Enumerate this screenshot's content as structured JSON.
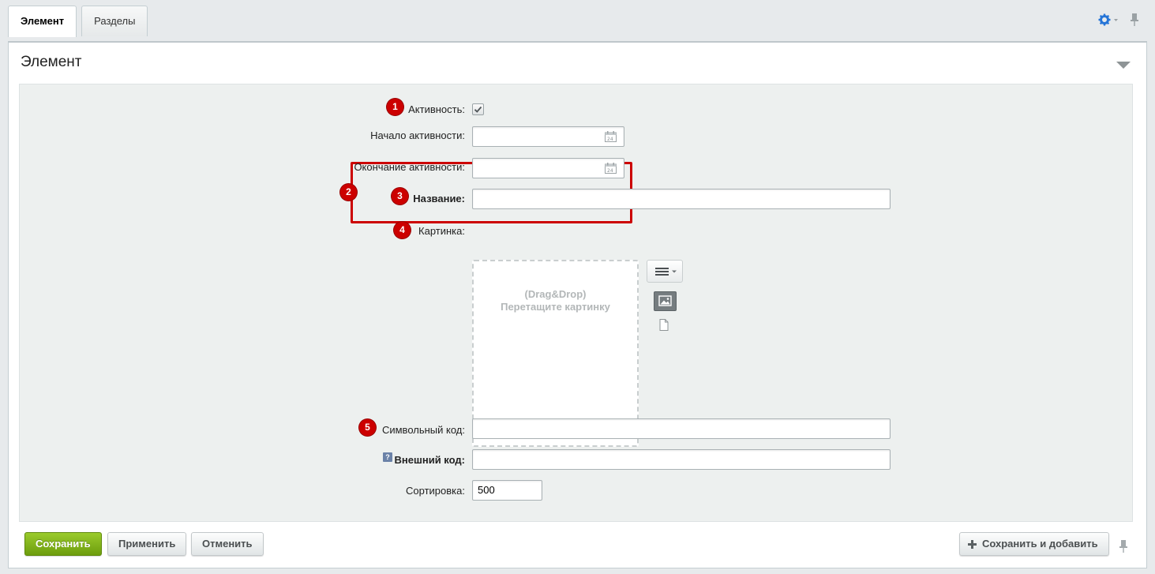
{
  "tabs": [
    {
      "label": "Элемент",
      "active": true
    },
    {
      "label": "Разделы",
      "active": false
    }
  ],
  "panel": {
    "title": "Элемент"
  },
  "form": {
    "active": {
      "badge": "1",
      "label": "Активность:",
      "checked": true
    },
    "date_group": {
      "badge": "2"
    },
    "active_from": {
      "label": "Начало активности:",
      "value": ""
    },
    "active_to": {
      "label": "Окончание активности:",
      "value": ""
    },
    "name": {
      "badge": "3",
      "label": "Название:",
      "value": ""
    },
    "picture": {
      "badge": "4",
      "label": "Картинка:",
      "dropzone_line1": "(Drag&Drop)",
      "dropzone_line2": "Перетащите картинку"
    },
    "code": {
      "badge": "5",
      "label": "Символьный код:",
      "value": ""
    },
    "xml_id": {
      "label": "Внешний код:",
      "help": "?",
      "value": ""
    },
    "sort": {
      "label": "Сортировка:",
      "value": "500"
    }
  },
  "buttons": {
    "save": "Сохранить",
    "apply": "Применить",
    "cancel": "Отменить",
    "save_and_add": "Сохранить и добавить"
  },
  "colors": {
    "accent": "#2675d7",
    "highlight": "#cc0000",
    "primary_button": "#7fb01a"
  }
}
